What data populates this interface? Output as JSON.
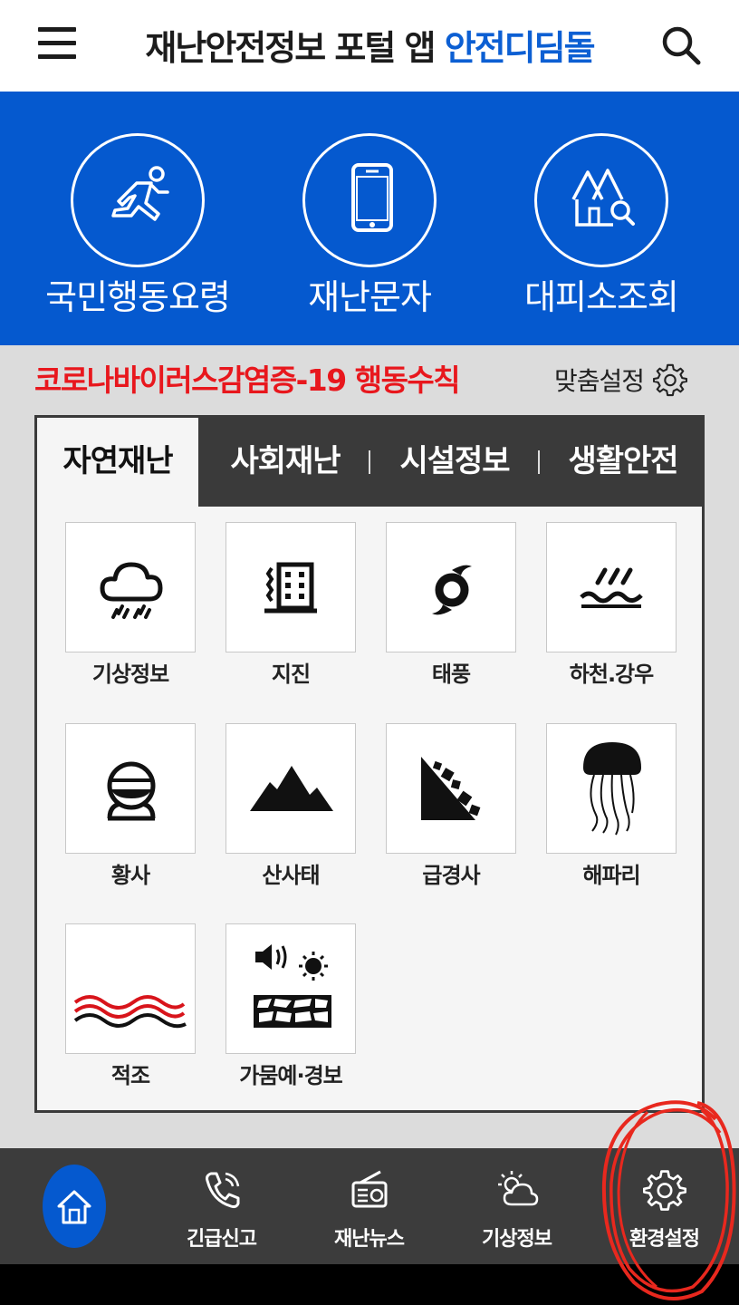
{
  "header": {
    "title_main": "재난안전정보 포털 앱",
    "title_accent": "안전디딤돌",
    "menu_icon": "hamburger-menu-icon",
    "search_icon": "search-icon"
  },
  "hero": [
    {
      "label": "국민행동요령",
      "icon": "running-person-icon"
    },
    {
      "label": "재난문자",
      "icon": "smartphone-icon"
    },
    {
      "label": "대피소조회",
      "icon": "shelter-search-icon"
    }
  ],
  "notice": {
    "text": "코로나바이러스감염증-19 행동수칙",
    "color": "#e8171d"
  },
  "custom_setting": {
    "label": "맞춤설정",
    "icon": "gear-icon"
  },
  "tabs": [
    {
      "label": "자연재난",
      "active": true
    },
    {
      "label": "사회재난",
      "active": false
    },
    {
      "label": "시설정보",
      "active": false
    },
    {
      "label": "생활안전",
      "active": false
    }
  ],
  "tiles": [
    {
      "label": "기상정보",
      "icon": "rain-cloud-icon"
    },
    {
      "label": "지진",
      "icon": "earthquake-building-icon"
    },
    {
      "label": "태풍",
      "icon": "typhoon-icon"
    },
    {
      "label": "하천.강우",
      "icon": "river-rain-icon"
    },
    {
      "label": "황사",
      "icon": "mask-face-icon"
    },
    {
      "label": "산사태",
      "icon": "mountain-icon"
    },
    {
      "label": "급경사",
      "icon": "steep-slope-icon"
    },
    {
      "label": "해파리",
      "icon": "jellyfish-icon"
    },
    {
      "label": "적조",
      "icon": "red-tide-icon"
    },
    {
      "label": "가뭄예·경보",
      "icon": "drought-icon"
    }
  ],
  "bottom_nav": [
    {
      "label": "",
      "icon": "home-icon",
      "active": true
    },
    {
      "label": "긴급신고",
      "icon": "phone-icon"
    },
    {
      "label": "재난뉴스",
      "icon": "radio-icon"
    },
    {
      "label": "기상정보",
      "icon": "weather-icon"
    },
    {
      "label": "환경설정",
      "icon": "gear-icon"
    }
  ],
  "colors": {
    "primary_blue": "#0559cf",
    "accent_blue": "#0c5fd3",
    "dark_gray": "#3a3a3a",
    "annotation_red": "#e8281e"
  }
}
